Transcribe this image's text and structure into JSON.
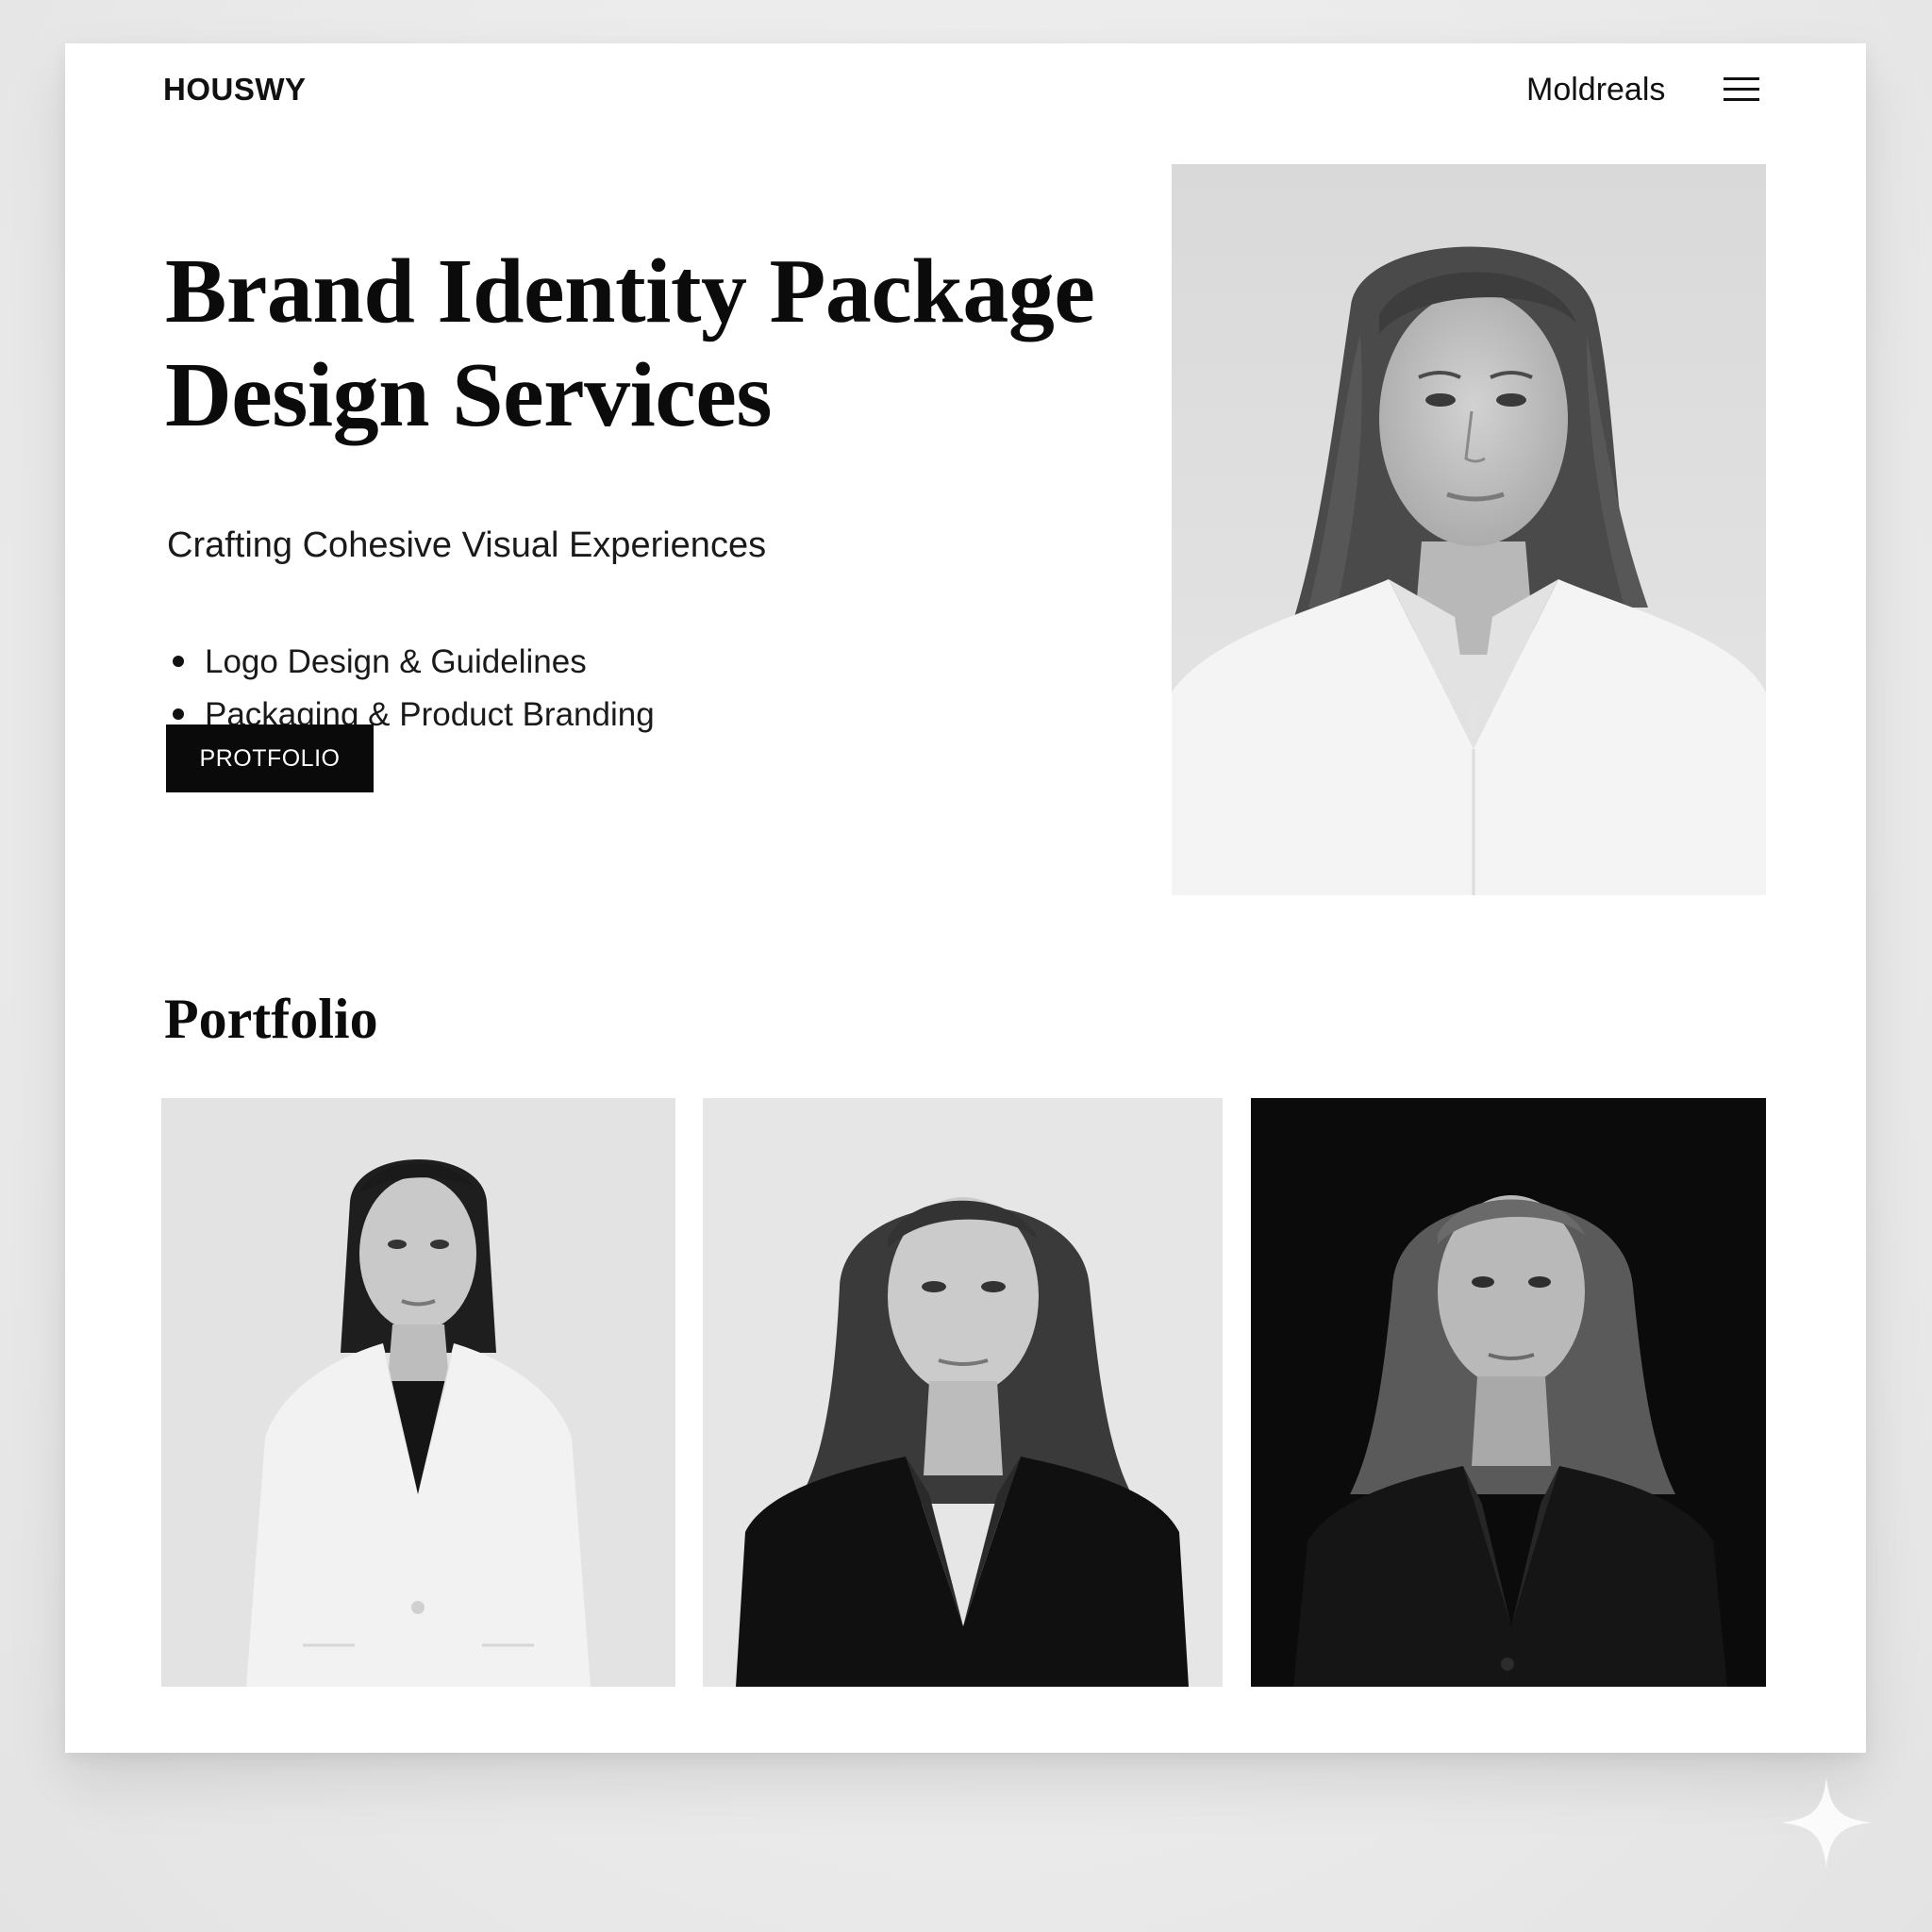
{
  "header": {
    "logo": "HOUSWY",
    "nav_link": "Moldreals",
    "menu_icon": "hamburger-menu-icon"
  },
  "hero": {
    "title_lines": [
      "Brand Identity Package",
      "Design Services"
    ],
    "subtitle": "Crafting Cohesive Visual Experiences",
    "features": [
      "Logo Design & Guidelines",
      "Packaging & Product Branding"
    ],
    "cta_label": "PROTFOLIO",
    "image": "portrait-woman-white-shirt"
  },
  "portfolio": {
    "heading": "Portfolio",
    "items": [
      {
        "image": "portrait-woman-white-blazer"
      },
      {
        "image": "portrait-woman-black-blazer-light-bg"
      },
      {
        "image": "portrait-woman-black-blazer-dark-bg"
      }
    ]
  },
  "colors": {
    "background": "#ececec",
    "page": "#ffffff",
    "text": "#0b0b0b",
    "button": "#0a0a0a",
    "button_text": "#ffffff"
  }
}
